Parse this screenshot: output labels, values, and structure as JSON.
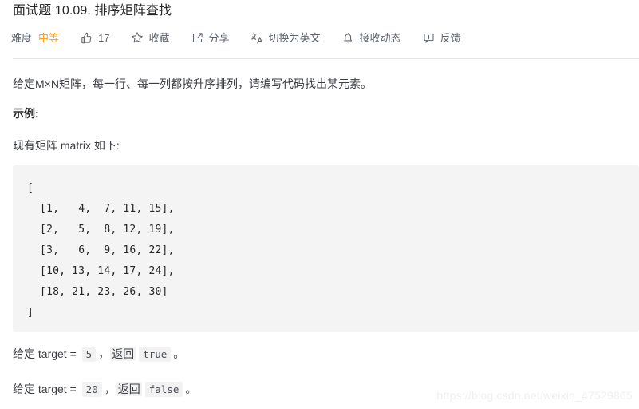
{
  "header": {
    "title": "面试题 10.09. 排序矩阵查找"
  },
  "toolbar": {
    "difficulty_label": "难度",
    "difficulty_value": "中等",
    "difficulty_color": "#ffa116",
    "like_icon": "thumbs-up-icon",
    "like_count": "17",
    "favorite_icon": "star-icon",
    "favorite_label": "收藏",
    "share_icon": "share-icon",
    "share_label": "分享",
    "translate_icon": "translate-icon",
    "translate_label": "切换为英文",
    "subscribe_icon": "bell-icon",
    "subscribe_label": "接收动态",
    "feedback_icon": "feedback-icon",
    "feedback_label": "反馈"
  },
  "content": {
    "description": "给定M×N矩阵，每一行、每一列都按升序排列，请编写代码找出某元素。",
    "example_heading": "示例:",
    "matrix_intro": "现有矩阵 matrix 如下:",
    "code": "[\n  [1,   4,  7, 11, 15],\n  [2,   5,  8, 12, 19],\n  [3,   6,  9, 16, 22],\n  [10, 13, 14, 17, 24],\n  [18, 21, 23, 26, 30]\n]",
    "case1": {
      "prefix": "给定 target = ",
      "target": "5",
      "middle_comma": "，",
      "return_word": "返回",
      "result": "true",
      "suffix": "。"
    },
    "case2": {
      "prefix": "给定 target = ",
      "target": "20",
      "middle_comma": "，",
      "return_word": "返回",
      "result": "false",
      "suffix": "。"
    }
  },
  "watermark": {
    "text": "https://blog.csdn.net/weixin_47529865"
  }
}
